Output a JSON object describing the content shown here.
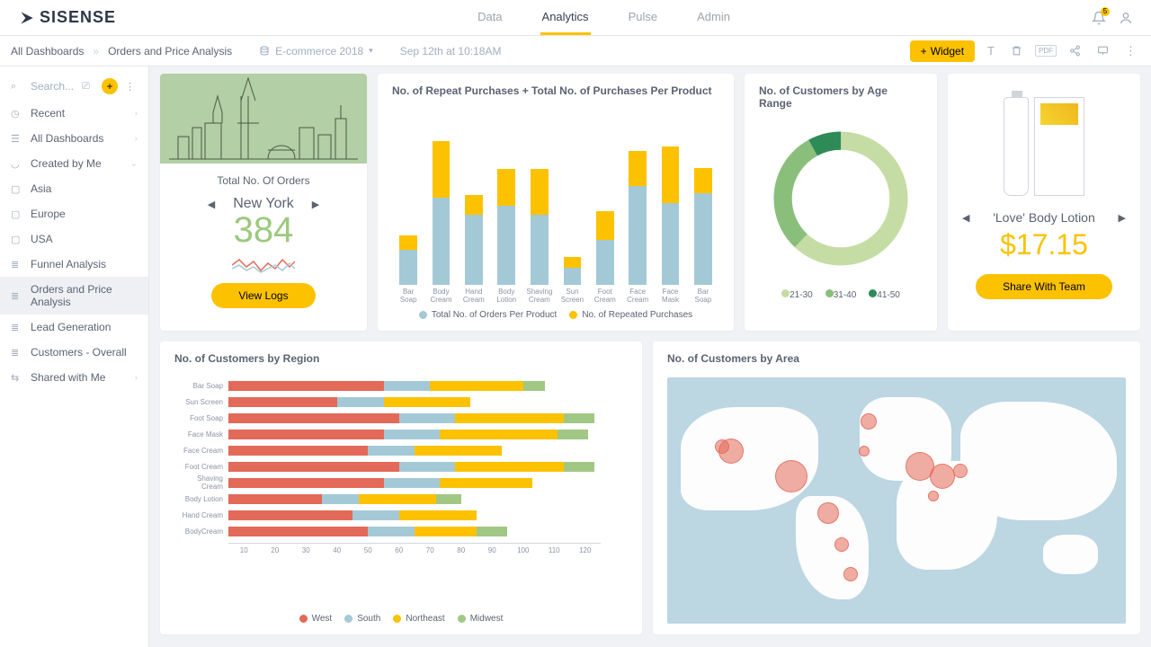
{
  "nav": {
    "logo": "SISENSE",
    "items": [
      "Data",
      "Analytics",
      "Pulse",
      "Admin"
    ],
    "active": 1,
    "notif": "5"
  },
  "crumb": {
    "root": "All Dashboards",
    "current": "Orders and Price Analysis",
    "context": "E-commerce 2018",
    "timestamp": "Sep 12th at 10:18AM",
    "widget_btn": "Widget"
  },
  "sidebar": {
    "search_placeholder": "Search...",
    "recent": "Recent",
    "all": "All Dashboards",
    "created": "Created by Me",
    "folders": [
      "Asia",
      "Europe",
      "USA",
      "Funnel Analysis",
      "Orders and Price Analysis",
      "Lead Generation",
      "Customers - Overall"
    ],
    "selected_idx": 4,
    "shared": "Shared with Me"
  },
  "orders_card": {
    "title": "Total No. Of Orders",
    "city": "New York",
    "value": "384",
    "button": "View Logs"
  },
  "product_card": {
    "name": "'Love' Body Lotion",
    "price": "$17.15",
    "button": "Share With Team"
  },
  "chart_data": [
    {
      "type": "bar",
      "title": "No. of Repeat Purchases + Total No. of Purchases Per Product",
      "categories": [
        "Bar Soap",
        "Body Cream",
        "Hand Cream",
        "Body Lotion",
        "Shaving Cream",
        "Sun Screen",
        "Foot Cream",
        "Face Cream",
        "Face Mask",
        "Bar Soap"
      ],
      "series": [
        {
          "name": "Total No. of Orders Per Product",
          "values": [
            25,
            62,
            50,
            56,
            50,
            12,
            32,
            70,
            58,
            65
          ]
        },
        {
          "name": "No. of Repeated Purchases",
          "values": [
            10,
            40,
            14,
            26,
            32,
            8,
            20,
            25,
            40,
            18
          ]
        }
      ],
      "colors": [
        "#a4c9d6",
        "#fcc200"
      ]
    },
    {
      "type": "pie",
      "title": "No. of Customers by Age Range",
      "series": [
        {
          "name": "21-30",
          "value": 62,
          "color": "#c5dda4"
        },
        {
          "name": "31-40",
          "value": 30,
          "color": "#8abf7b"
        },
        {
          "name": "41-50",
          "value": 8,
          "color": "#2e8b57"
        }
      ]
    },
    {
      "type": "bar",
      "title": "No. of Customers by Region",
      "orientation": "horizontal",
      "categories": [
        "Bar Soap",
        "Sun Screen",
        "Foot Soap",
        "Face Mask",
        "Face Cream",
        "Foot Cream",
        "Shaving Cream",
        "Body Lotion",
        "Hand Cream",
        "BodyCream"
      ],
      "series": [
        {
          "name": "West",
          "values": [
            50,
            35,
            55,
            50,
            45,
            55,
            50,
            30,
            40,
            45
          ]
        },
        {
          "name": "South",
          "values": [
            15,
            15,
            18,
            18,
            15,
            18,
            18,
            12,
            15,
            15
          ]
        },
        {
          "name": "Northeast",
          "values": [
            30,
            28,
            35,
            38,
            28,
            35,
            30,
            25,
            25,
            20
          ]
        },
        {
          "name": "Midwest",
          "values": [
            7,
            0,
            10,
            10,
            0,
            10,
            0,
            8,
            0,
            10
          ]
        }
      ],
      "xticks": [
        10,
        20,
        30,
        40,
        50,
        60,
        70,
        80,
        90,
        100,
        110,
        120
      ],
      "colors": [
        "#e36959",
        "#a4c9d6",
        "#fcc200",
        "#a0c884"
      ]
    },
    {
      "type": "map",
      "title": "No. of Customers by Area",
      "points": [
        {
          "x": 12,
          "y": 28,
          "r": 8
        },
        {
          "x": 14,
          "y": 30,
          "r": 14
        },
        {
          "x": 27,
          "y": 40,
          "r": 18
        },
        {
          "x": 35,
          "y": 55,
          "r": 12
        },
        {
          "x": 38,
          "y": 68,
          "r": 8
        },
        {
          "x": 40,
          "y": 80,
          "r": 8
        },
        {
          "x": 44,
          "y": 18,
          "r": 9
        },
        {
          "x": 55,
          "y": 36,
          "r": 16
        },
        {
          "x": 60,
          "y": 40,
          "r": 14
        },
        {
          "x": 64,
          "y": 38,
          "r": 8
        },
        {
          "x": 58,
          "y": 48,
          "r": 6
        },
        {
          "x": 43,
          "y": 30,
          "r": 6
        }
      ]
    }
  ]
}
